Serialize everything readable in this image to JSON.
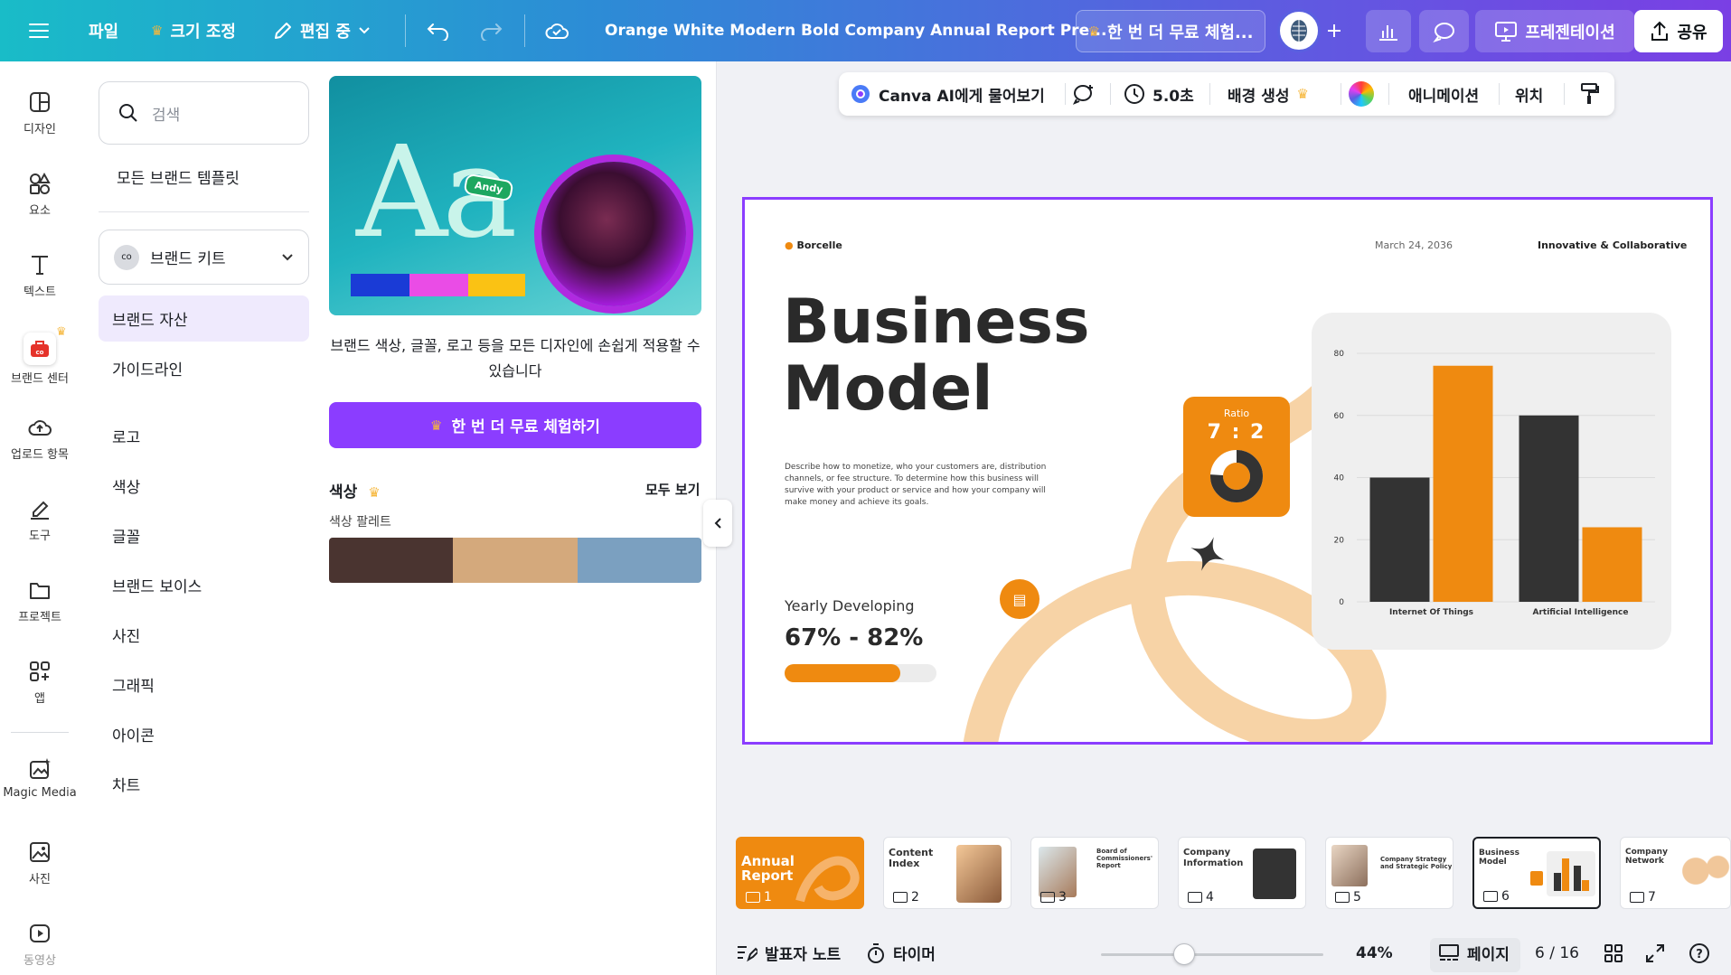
{
  "topbar": {
    "file": "파일",
    "resize": "크기 조정",
    "editing": "편집 중",
    "doc_title": "Orange White Modern Bold Company Annual Report Pre...",
    "trial": "한 번 더 무료 체험...",
    "present": "프레젠테이션",
    "share": "공유"
  },
  "rail": [
    {
      "label": "디자인",
      "icon": "design-icon"
    },
    {
      "label": "요소",
      "icon": "elements-icon"
    },
    {
      "label": "텍스트",
      "icon": "text-icon"
    },
    {
      "label": "브랜드 센터",
      "icon": "brand-icon"
    },
    {
      "label": "업로드 항목",
      "icon": "upload-icon"
    },
    {
      "label": "도구",
      "icon": "tools-icon"
    },
    {
      "label": "프로젝트",
      "icon": "folder-icon"
    },
    {
      "label": "앱",
      "icon": "apps-icon"
    },
    {
      "label": "Magic Media",
      "icon": "magic-media-icon"
    },
    {
      "label": "사진",
      "icon": "photo-icon"
    },
    {
      "label": "동영상",
      "icon": "video-icon"
    }
  ],
  "panel": {
    "search_placeholder": "검색",
    "all_templates": "모든 브랜드 템플릿",
    "brand_kit": "브랜드 키트",
    "nav": [
      "브랜드 자산",
      "가이드라인",
      "로고",
      "색상",
      "글꼴",
      "브랜드 보이스",
      "사진",
      "그래픽",
      "아이콘",
      "차트"
    ],
    "hero_tag": "Andy",
    "desc": "브랜드 색상, 글꼴, 로고 등을 모든 디자인에 손쉽게 적용할 수 있습니다",
    "cta": "한 번 더 무료 체험하기",
    "colors_title": "색상",
    "see_all": "모두 보기",
    "palette_label": "색상 팔레트",
    "palette": [
      "#4a3430",
      "#d4a97c",
      "#7ba0c0"
    ],
    "hero_bar_colors": [
      "#1a3bd6",
      "#ea4ce6",
      "#fac214"
    ]
  },
  "context_bar": {
    "ask_ai": "Canva AI에게 물어보기",
    "duration": "5.0초",
    "bg_gen": "배경 생성",
    "animation": "애니메이션",
    "position": "위치"
  },
  "slide": {
    "brand": "Borcelle",
    "date": "March 24, 2036",
    "tagline": "Innovative & Collaborative",
    "title_line1": "Business",
    "title_line2": "Model",
    "body": "Describe how to monetize, who your customers are, distribution channels, or fee structure. To determine how this business will survive with your product or service and how your company will make money and achieve its goals.",
    "ratio_label": "Ratio",
    "ratio_value": "7 : 2",
    "yearly_label": "Yearly Developing",
    "yearly_value": "67% - 82%",
    "progress": 0.76,
    "accent": "#ef8a10",
    "dark": "#333333"
  },
  "chart_data": {
    "type": "bar",
    "categories": [
      "Internet Of Things",
      "Artificial Intelligence"
    ],
    "series": [
      {
        "values": [
          40,
          60
        ]
      },
      {
        "values": [
          76,
          24
        ]
      }
    ],
    "ylim": [
      0,
      80
    ],
    "yticks": [
      0,
      20,
      40,
      60,
      80
    ],
    "colors": [
      "#333333",
      "#ef8a10"
    ],
    "grid": true
  },
  "thumbnails": [
    {
      "title": "Annual\nReport",
      "num": "1"
    },
    {
      "title": "Content\nIndex",
      "num": "2"
    },
    {
      "title": "Board of\nCommissioners'\nReport",
      "num": "3"
    },
    {
      "title": "Company\nInformation",
      "num": "4"
    },
    {
      "title": "Company Strategy\nand Strategic Policy",
      "num": "5"
    },
    {
      "title": "Business\nModel",
      "num": "6"
    },
    {
      "title": "Company\nNetwork",
      "num": "7"
    }
  ],
  "bottombar": {
    "notes": "발표자 노트",
    "timer": "타이머",
    "zoom": "44%",
    "pages": "페이지",
    "page_count": "6 / 16"
  }
}
